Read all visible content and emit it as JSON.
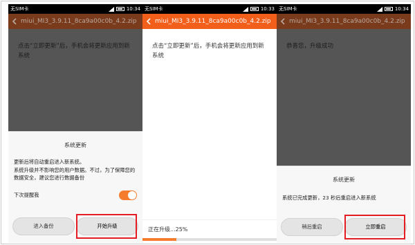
{
  "status_bar": {
    "carrier": "无SIM卡",
    "time": "10:34",
    "time_middle": "10:33"
  },
  "title": "miui_MI3_3.9.11_8ca9a00c0b_4.2.zip",
  "screens": [
    {
      "message": "点击“立即更新”后，手机会将更新应用到新系统",
      "dialog": {
        "title": "系统更新",
        "body": "更新后将自动重启进入新系统。\n系统升级并不影响您的用户数据。不过，为了保障您的数据安全，建议您进行数据备份",
        "toggle_label": "下次提醒我",
        "toggle_on": true,
        "left_button": "进入备份",
        "right_button": "开始升级"
      }
    },
    {
      "message": "点击“立即更新”后，手机会将更新应用到新系统",
      "progress_text": "正在升级...25%",
      "progress": 0.25
    },
    {
      "message": "恭喜您，升级成功",
      "dialog": {
        "title": "系统更新",
        "body": "系统已完成更新，23 秒后重启进入新系统",
        "left_button": "稍后重启",
        "right_button": "立即重启"
      }
    }
  ],
  "colors": {
    "accent": "#f25f1b",
    "highlight": "#e31b23",
    "dim_overlay": "#555555"
  }
}
